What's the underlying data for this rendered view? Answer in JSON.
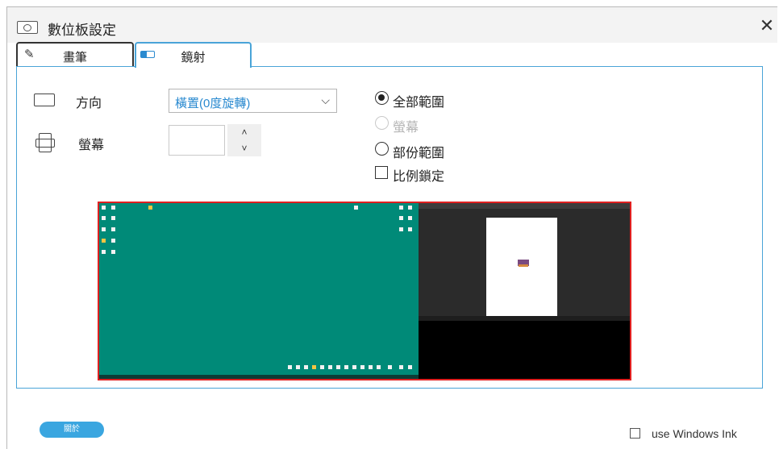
{
  "window": {
    "title": "數位板設定",
    "close_glyph": "✕"
  },
  "tabs": [
    {
      "label": "畫筆",
      "icon": "pen-icon"
    },
    {
      "label": "鏡射",
      "icon": "mirror-icon",
      "active": true
    }
  ],
  "settings": {
    "orientation_label": "方向",
    "orientation_value": "橫置(0度旋轉)",
    "screen_label": "螢幕",
    "screen_value": "",
    "spinner_up": "˄",
    "spinner_down": "˅"
  },
  "mapping_options": {
    "full_area": "全部範圍",
    "screen": "螢幕",
    "partial_area": "部份範圍",
    "lock_ratio": "比例鎖定",
    "selected": "full_area"
  },
  "footer": {
    "about_label": "關於",
    "use_windows_ink_label": "use Windows Ink",
    "use_windows_ink_checked": false
  },
  "colors": {
    "accent": "#4aa4d8",
    "preview_border": "#e02020",
    "desktop_green": "#008a78",
    "about_button": "#3aa6e0"
  }
}
